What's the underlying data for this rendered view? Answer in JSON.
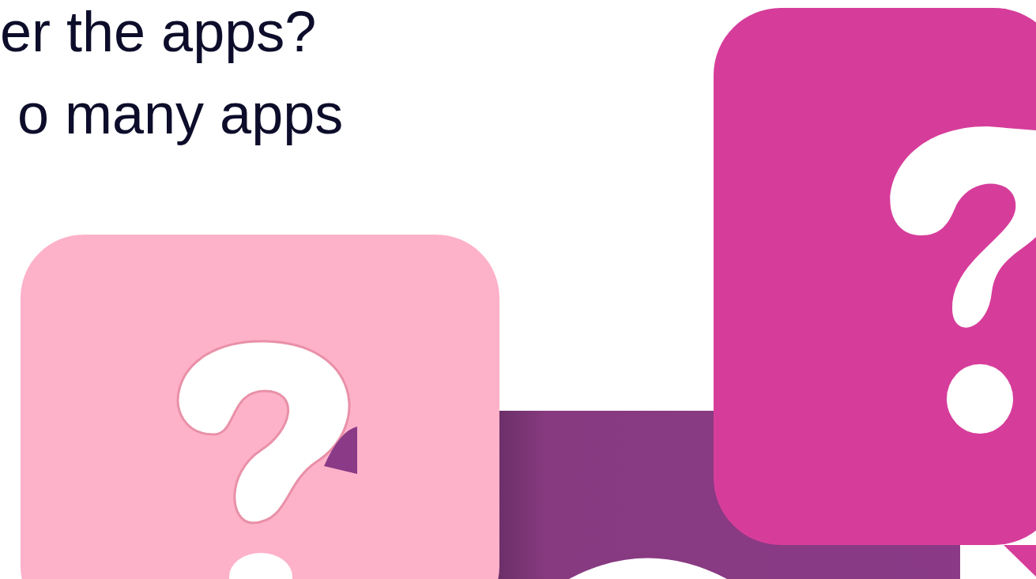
{
  "heading": {
    "lines": [
      "er the apps?",
      "o many apps"
    ]
  }
}
